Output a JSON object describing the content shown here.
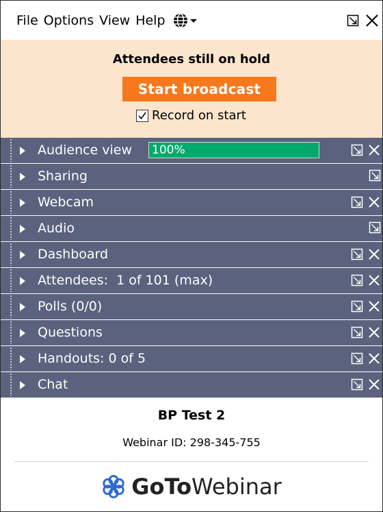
{
  "menu": {
    "items": [
      "File",
      "Options",
      "View",
      "Help"
    ]
  },
  "status": {
    "text": "Attendees still on hold"
  },
  "broadcast": {
    "label": "Start broadcast"
  },
  "record": {
    "label": "Record on start",
    "checked": true
  },
  "panels": [
    {
      "label": "Audience view",
      "progress": "100%",
      "progress_value": 100,
      "controls": [
        "popout-icon",
        "close-icon"
      ]
    },
    {
      "label": "Sharing",
      "controls": [
        "popout-icon"
      ]
    },
    {
      "label": "Webcam",
      "controls": [
        "popout-icon",
        "close-icon"
      ]
    },
    {
      "label": "Audio",
      "controls": [
        "popout-icon"
      ]
    },
    {
      "label": "Dashboard",
      "controls": [
        "popout-icon",
        "close-icon"
      ]
    },
    {
      "label": "Attendees:  1 of 101 (max)",
      "controls": [
        "popout-icon",
        "close-icon"
      ]
    },
    {
      "label": "Polls (0/0)",
      "controls": [
        "popout-icon",
        "close-icon"
      ]
    },
    {
      "label": "Questions",
      "controls": [
        "popout-icon",
        "close-icon"
      ]
    },
    {
      "label": "Handouts: 0 of 5",
      "controls": [
        "popout-icon",
        "close-icon"
      ]
    },
    {
      "label": "Chat",
      "controls": [
        "popout-icon",
        "close-icon"
      ]
    }
  ],
  "webinar": {
    "title": "BP Test 2",
    "id_text": "Webinar ID: 298-345-755"
  },
  "logo": {
    "goto": "GoTo",
    "webinar": "Webinar"
  },
  "colors": {
    "accent": "#f7781d",
    "panel_bg": "#5a627d",
    "header_bg": "#fbe6cd",
    "progress": "#00aa6c",
    "logo_blue": "#2d6bd1"
  }
}
